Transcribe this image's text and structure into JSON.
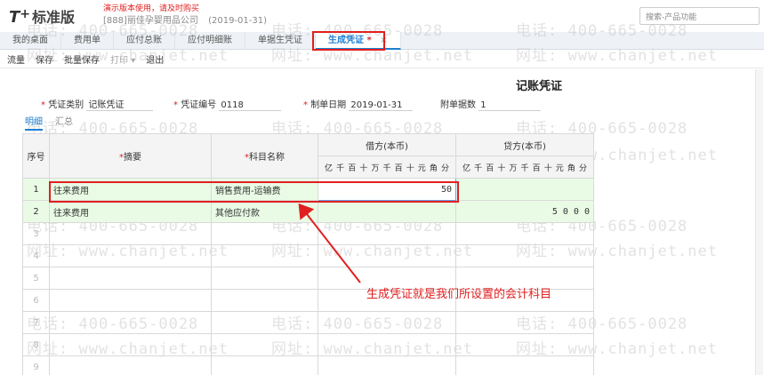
{
  "header": {
    "logo_mark": "T",
    "logo_plus": "+",
    "logo_name": "标准版",
    "demo_notice": "演示版本使用，请及时购买",
    "company": "[888]丽佳孕婴用品公司",
    "date": "(2019-01-31)",
    "search_placeholder": "搜索-产品功能"
  },
  "tabs": [
    {
      "label": "我的桌面"
    },
    {
      "label": "费用单"
    },
    {
      "label": "应付总账"
    },
    {
      "label": "应付明细账"
    },
    {
      "label": "单据生凭证"
    },
    {
      "label": "生成凭证",
      "modified": "*",
      "close": "×"
    }
  ],
  "toolbar": {
    "flow": "流量",
    "save": "保存",
    "batch_save": "批量保存",
    "print": "打印",
    "print_caret": "▾",
    "exit": "退出"
  },
  "document": {
    "title": "记账凭证",
    "voucher_type_label": "凭证类别",
    "voucher_type_value": "记账凭证",
    "voucher_no_label": "凭证编号",
    "voucher_no_value": "0118",
    "date_label": "制单日期",
    "date_value": "2019-01-31",
    "attachments_label": "附单据数",
    "attachments_value": "1",
    "req_mark": "*"
  },
  "subtabs": {
    "detail": "明细",
    "summary": "汇总"
  },
  "grid": {
    "col_seq": "序号",
    "col_summary": "摘要",
    "col_account": "科目名称",
    "col_debit": "借方(本币)",
    "col_credit": "贷方(本币)",
    "digits": [
      "亿",
      "千",
      "百",
      "十",
      "万",
      "千",
      "百",
      "十",
      "元",
      "角",
      "分"
    ],
    "rows": [
      {
        "seq": "1",
        "summary": "往来费用",
        "account": "销售费用-运输费",
        "debit": "50",
        "credit": ""
      },
      {
        "seq": "2",
        "summary": "往来费用",
        "account": "其他应付款",
        "debit": "",
        "credit": "5 0 0 0"
      },
      {
        "seq": "3",
        "summary": "",
        "account": "",
        "debit": "",
        "credit": ""
      },
      {
        "seq": "4",
        "summary": "",
        "account": "",
        "debit": "",
        "credit": ""
      },
      {
        "seq": "5",
        "summary": "",
        "account": "",
        "debit": "",
        "credit": ""
      },
      {
        "seq": "6",
        "summary": "",
        "account": "",
        "debit": "",
        "credit": ""
      },
      {
        "seq": "7",
        "summary": "",
        "account": "",
        "debit": "",
        "credit": ""
      },
      {
        "seq": "8",
        "summary": "",
        "account": "",
        "debit": "",
        "credit": ""
      },
      {
        "seq": "9",
        "summary": "",
        "account": "",
        "debit": "",
        "credit": ""
      }
    ]
  },
  "annotation": "生成凭证就是我们所设置的会计科目",
  "watermark": {
    "phone": "电话: 400-665-0028",
    "site": "网址: www.chanjet.net"
  },
  "colors": {
    "accent": "#1e7fd2",
    "highlight": "#e02020",
    "row_bg": "#e9fbe5"
  }
}
